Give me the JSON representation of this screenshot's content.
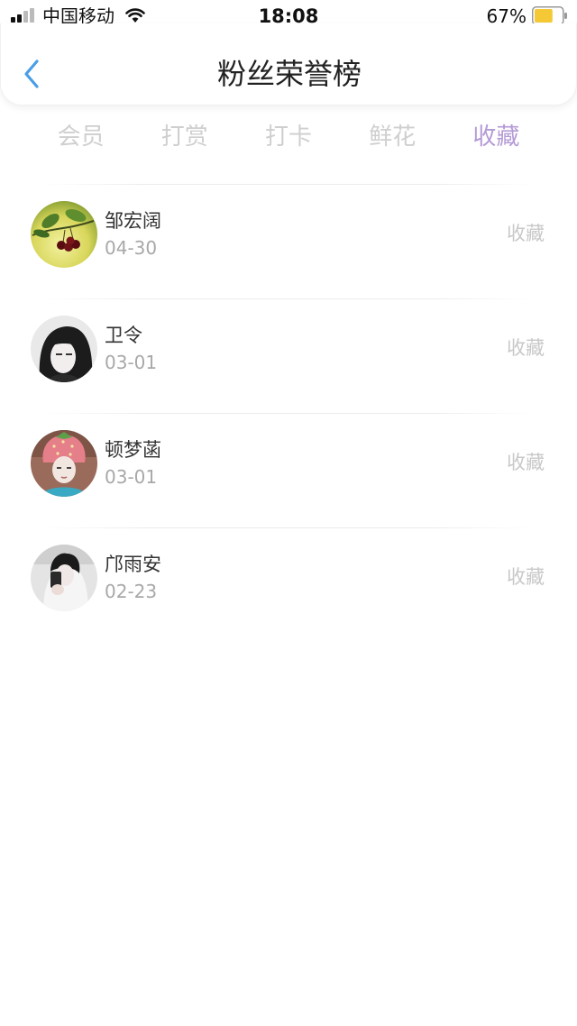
{
  "status_bar": {
    "carrier": "中国移动",
    "time": "18:08",
    "battery_percent": "67%",
    "battery_level": 0.67,
    "battery_color": "#f5c936"
  },
  "header": {
    "title": "粉丝荣誉榜",
    "back_icon": "chevron-left-icon",
    "accent": "#4a9ee6"
  },
  "tabs": [
    {
      "label": "会员",
      "active": false
    },
    {
      "label": "打赏",
      "active": false
    },
    {
      "label": "打卡",
      "active": false
    },
    {
      "label": "鲜花",
      "active": false
    },
    {
      "label": "收藏",
      "active": true
    }
  ],
  "tab_active_color": "#b49ad6",
  "fans": [
    {
      "name": "邹宏阔",
      "date": "04-30",
      "action": "收藏",
      "avatar": "cherry-photo"
    },
    {
      "name": "卫令",
      "date": "03-01",
      "action": "收藏",
      "avatar": "girl-black-hair-photo"
    },
    {
      "name": "顿梦菡",
      "date": "03-01",
      "action": "收藏",
      "avatar": "strawberry-hat-photo"
    },
    {
      "name": "邝雨安",
      "date": "02-23",
      "action": "收藏",
      "avatar": "selfie-photo"
    }
  ]
}
